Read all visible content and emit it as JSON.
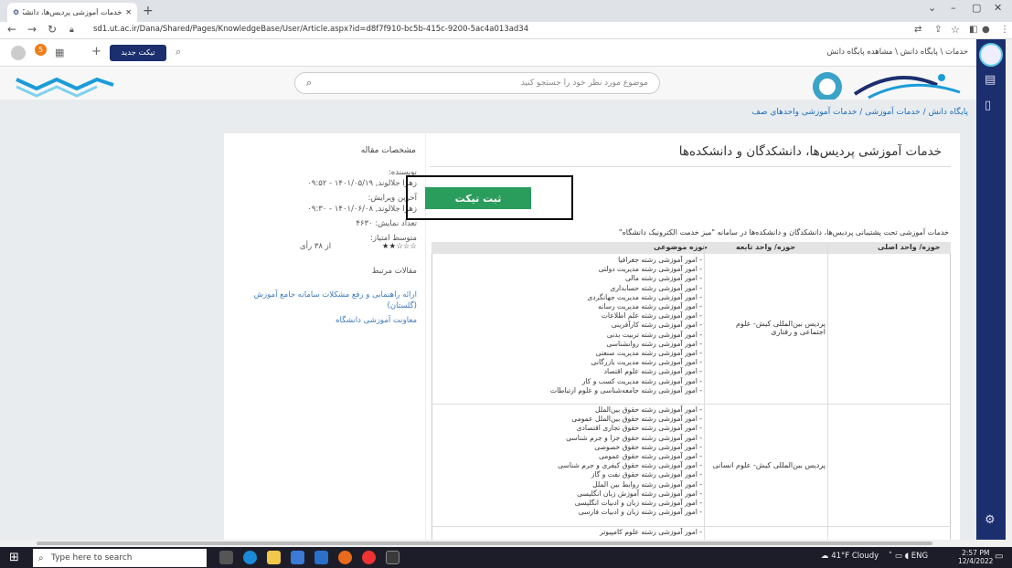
{
  "browser": {
    "tab_title": "خدمات آموزشی پردیس‌ها، دانشکدگان و دان...",
    "url": "sd1.ut.ac.ir/Dana/Shared/Pages/KnowledgeBase/User/Article.aspx?id=d8f7f910-bc5b-415c-9200-5ac4a013ad34"
  },
  "header": {
    "new_ticket": "تیکت جدید",
    "top_breadcrumb": "خدمات \\ پایگاه دانش \\ مشاهده پایگاه دانش",
    "notif_count": "5"
  },
  "search": {
    "placeholder": "موضوع مورد نظر خود را جستجو کنید"
  },
  "breadcrumb": "پایگاه دانش / خدمات آموزشی / خدمات آموزشی واحدهای صف",
  "article": {
    "title": "خدمات آموزشی پردیس‌ها، دانشکدگان و دانشکده‌ها",
    "submit_ticket": "ثبت تیکت",
    "intro": "خدمات آموزشی تحت پشتیبانی پردیس‌ها، دانشکدگان و دانشکده‌ها در سامانه \"میز خدمت الکترونیک دانشگاه\""
  },
  "sidebar_info": {
    "heading": "مشخصات مقاله",
    "author_label": "نویسنده:",
    "author": "زهرا جلالوند, ۱۴۰۱/۰۵/۱۹ - ۰۹:۵۲",
    "edit_label": "آخرین ویرایش:",
    "edit": "زهرا جلالوند, ۱۴۰۱/۰۶/۰۸ - ۰۹:۳۰",
    "views": "تعداد نمایش: ۴۶۳۰",
    "rating_label": "متوسط امتیاز:",
    "rating_stars": "★★☆☆☆",
    "rating_votes": "از ۳۸ رأی",
    "related_heading": "مقالات مرتبط",
    "related": [
      "ارائه راهنمایی و رفع مشکلات سامانه جامع آموزش (گلستان)",
      "معاونت آموزشی دانشگاه"
    ]
  },
  "table": {
    "headers": [
      "حوزه/ واحد اصلی",
      "حوزه/ واحد تابعه",
      "حوزه موضوعی"
    ],
    "rows": [
      {
        "unit": "پردیس بین‌المللی کیش- علوم اجتماعی و رفتاری",
        "subjects": [
          "- امور آموزشی رشته جغرافیا",
          "- امور آموزشی رشته مدیریت دولتی",
          "- امور آموزشی رشته مالی",
          "- امور آموزشی رشته حسابداری",
          "- امور آموزشی رشته مدیریت جهانگردی",
          "- امور آموزشی رشته مدیریت رسانه",
          "- امور آموزشی رشته علم اطلاعات",
          "- امور آموزشی رشته کارآفرینی",
          "- امور آموزشی رشته تربیت بدنی",
          "- امور آموزشی رشته روانشناسی",
          "- امور آموزشی رشته مدیریت صنعتی",
          "- امور آموزشی رشته مدیریت بازرگانی",
          "- امور آموزشی رشته علوم اقتصاد",
          "- امور آموزشی رشته مدیریت کسب و کار",
          "- امور آموزشی رشته جامعه‌شناسی و علوم ارتباطات"
        ]
      },
      {
        "unit": "پردیس بین‌المللی کیش- علوم انسانی",
        "subjects": [
          "- امور آموزشی رشته حقوق بین‌الملل",
          "- امور آموزشی رشته حقوق بین‌الملل عمومی",
          "- امور آموزشی رشته حقوق تجاری اقتصادی",
          "- امور آموزشی رشته حقوق جزا و جرم شناسی",
          "- امور آموزشی رشته حقوق خصوصی",
          "- امور آموزشی رشته حقوق عمومی",
          "- امور آموزشی رشته حقوق کیفری و جرم شناسی",
          "- امور آموزشی رشته حقوق نفت و گاز",
          "- امور آموزشی رشته روابط بین الملل",
          "- امور آموزشی رشته آموزش زبان انگلیسی",
          "- امور آموزشی رشته زبان و ادبیات انگلیسی",
          "- امور آموزشی رشته زبان و ادبیات فارسی"
        ]
      },
      {
        "unit": "",
        "subjects": [
          "- امور آموزشی رشته علوم کامپیوتر"
        ]
      }
    ]
  },
  "taskbar": {
    "search_placeholder": "Type here to search",
    "weather": "41°F Cloudy",
    "lang": "ENG",
    "time": "2:57 PM",
    "date": "12/4/2022"
  },
  "colors": {
    "navy": "#1b2e6e",
    "green": "#2a9d5c",
    "link": "#1b6ebd"
  }
}
